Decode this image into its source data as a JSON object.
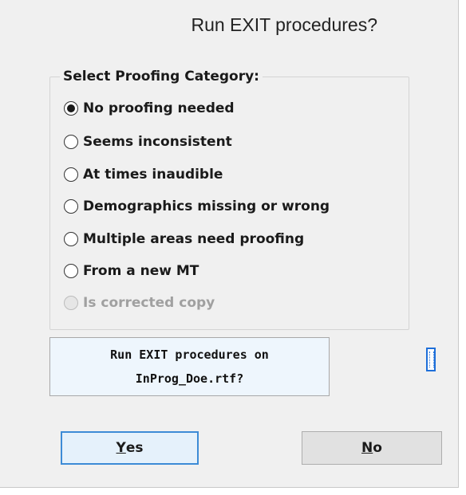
{
  "dialog": {
    "title": "Run EXIT procedures?"
  },
  "group": {
    "legend": "Select Proofing Category:",
    "options": [
      {
        "label": "No proofing needed",
        "checked": true,
        "disabled": false
      },
      {
        "label": "Seems inconsistent",
        "checked": false,
        "disabled": false
      },
      {
        "label": "At times inaudible",
        "checked": false,
        "disabled": false
      },
      {
        "label": "Demographics missing or wrong",
        "checked": false,
        "disabled": false
      },
      {
        "label": "Multiple areas need proofing",
        "checked": false,
        "disabled": false
      },
      {
        "label": "From a new MT",
        "checked": false,
        "disabled": false
      },
      {
        "label": "Is corrected copy",
        "checked": false,
        "disabled": true
      }
    ]
  },
  "message": {
    "line1": "Run EXIT procedures on",
    "line2": "InProg_Doe.rtf?"
  },
  "side_icon": "document-ruler-icon",
  "buttons": {
    "yes": {
      "mnemonic": "Y",
      "rest": "es"
    },
    "no": {
      "mnemonic": "N",
      "rest": "o"
    }
  },
  "colors": {
    "accent": "#3c8bd6",
    "message_bg": "#eef6fd",
    "dialog_bg": "#f0f0f0"
  }
}
